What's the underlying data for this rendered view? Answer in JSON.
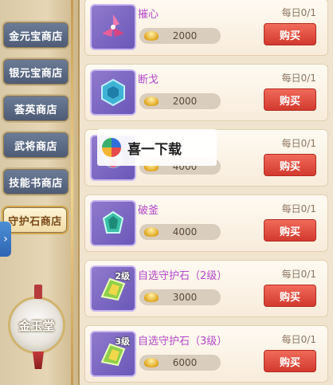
{
  "sidebar": {
    "tabs": [
      {
        "label": "金元宝商店",
        "active": false
      },
      {
        "label": "银元宝商店",
        "active": false
      },
      {
        "label": "荟英商店",
        "active": false
      },
      {
        "label": "武将商店",
        "active": false
      },
      {
        "label": "技能书商店",
        "active": false
      },
      {
        "label": "守护石商店",
        "active": true
      }
    ],
    "expand_icon": "chevron-right-icon",
    "bottom_button": "金玉堂"
  },
  "items": [
    {
      "name": "摧心",
      "daily": "每日0/1",
      "price": "2000",
      "buy": "购买",
      "gem_color": "#e0508f",
      "level": ""
    },
    {
      "name": "断戈",
      "daily": "每日0/1",
      "price": "2000",
      "buy": "购买",
      "gem_color": "#3fb3d6",
      "level": ""
    },
    {
      "name": "",
      "daily": "每日0/1",
      "price": "4000",
      "buy": "购买",
      "gem_color": "#9aa7d9",
      "level": ""
    },
    {
      "name": "破釜",
      "daily": "每日0/1",
      "price": "4000",
      "buy": "购买",
      "gem_color": "#3bbfa8",
      "level": ""
    },
    {
      "name": "自选守护石（2级）",
      "daily": "每日0/1",
      "price": "3000",
      "buy": "购买",
      "gem_color": "#8fcf4a",
      "level": "2级"
    },
    {
      "name": "自选守护石（3级）",
      "daily": "每日0/1",
      "price": "6000",
      "buy": "购买",
      "gem_color": "#8fcf4a",
      "level": "3级"
    }
  ],
  "watermark": {
    "text": "喜一下载"
  },
  "colors": {
    "accent": "#d23a2e",
    "item_name": "#b449c9",
    "tab_bg": "#5a6883"
  }
}
